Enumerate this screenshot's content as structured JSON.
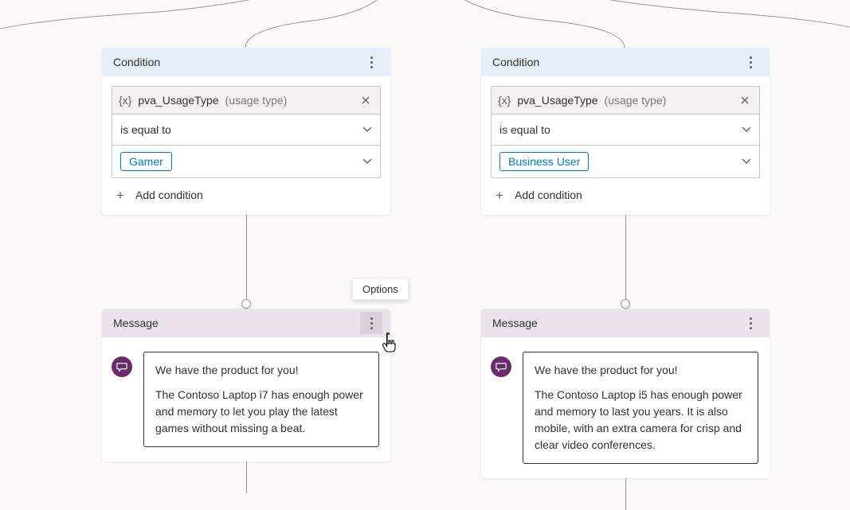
{
  "branches": [
    {
      "condition": {
        "title": "Condition",
        "variable_token": "{x}",
        "variable_name": "pva_UsageType",
        "variable_label": "(usage type)",
        "operator": "is equal to",
        "value_tag": "Gamer",
        "add_label": "Add condition"
      },
      "message": {
        "title": "Message",
        "line1": "We have the product for you!",
        "line2": "The Contoso Laptop i7 has enough power and memory to let you play the latest games without missing a beat."
      }
    },
    {
      "condition": {
        "title": "Condition",
        "variable_token": "{x}",
        "variable_name": "pva_UsageType",
        "variable_label": "(usage type)",
        "operator": "is equal to",
        "value_tag": "Business User",
        "add_label": "Add condition"
      },
      "message": {
        "title": "Message",
        "line1": "We have the product for you!",
        "line2": "The Contoso Laptop i5 has enough power and memory to last you years. It is also mobile, with an extra camera for crisp and clear video conferences."
      }
    }
  ],
  "tooltip": "Options"
}
